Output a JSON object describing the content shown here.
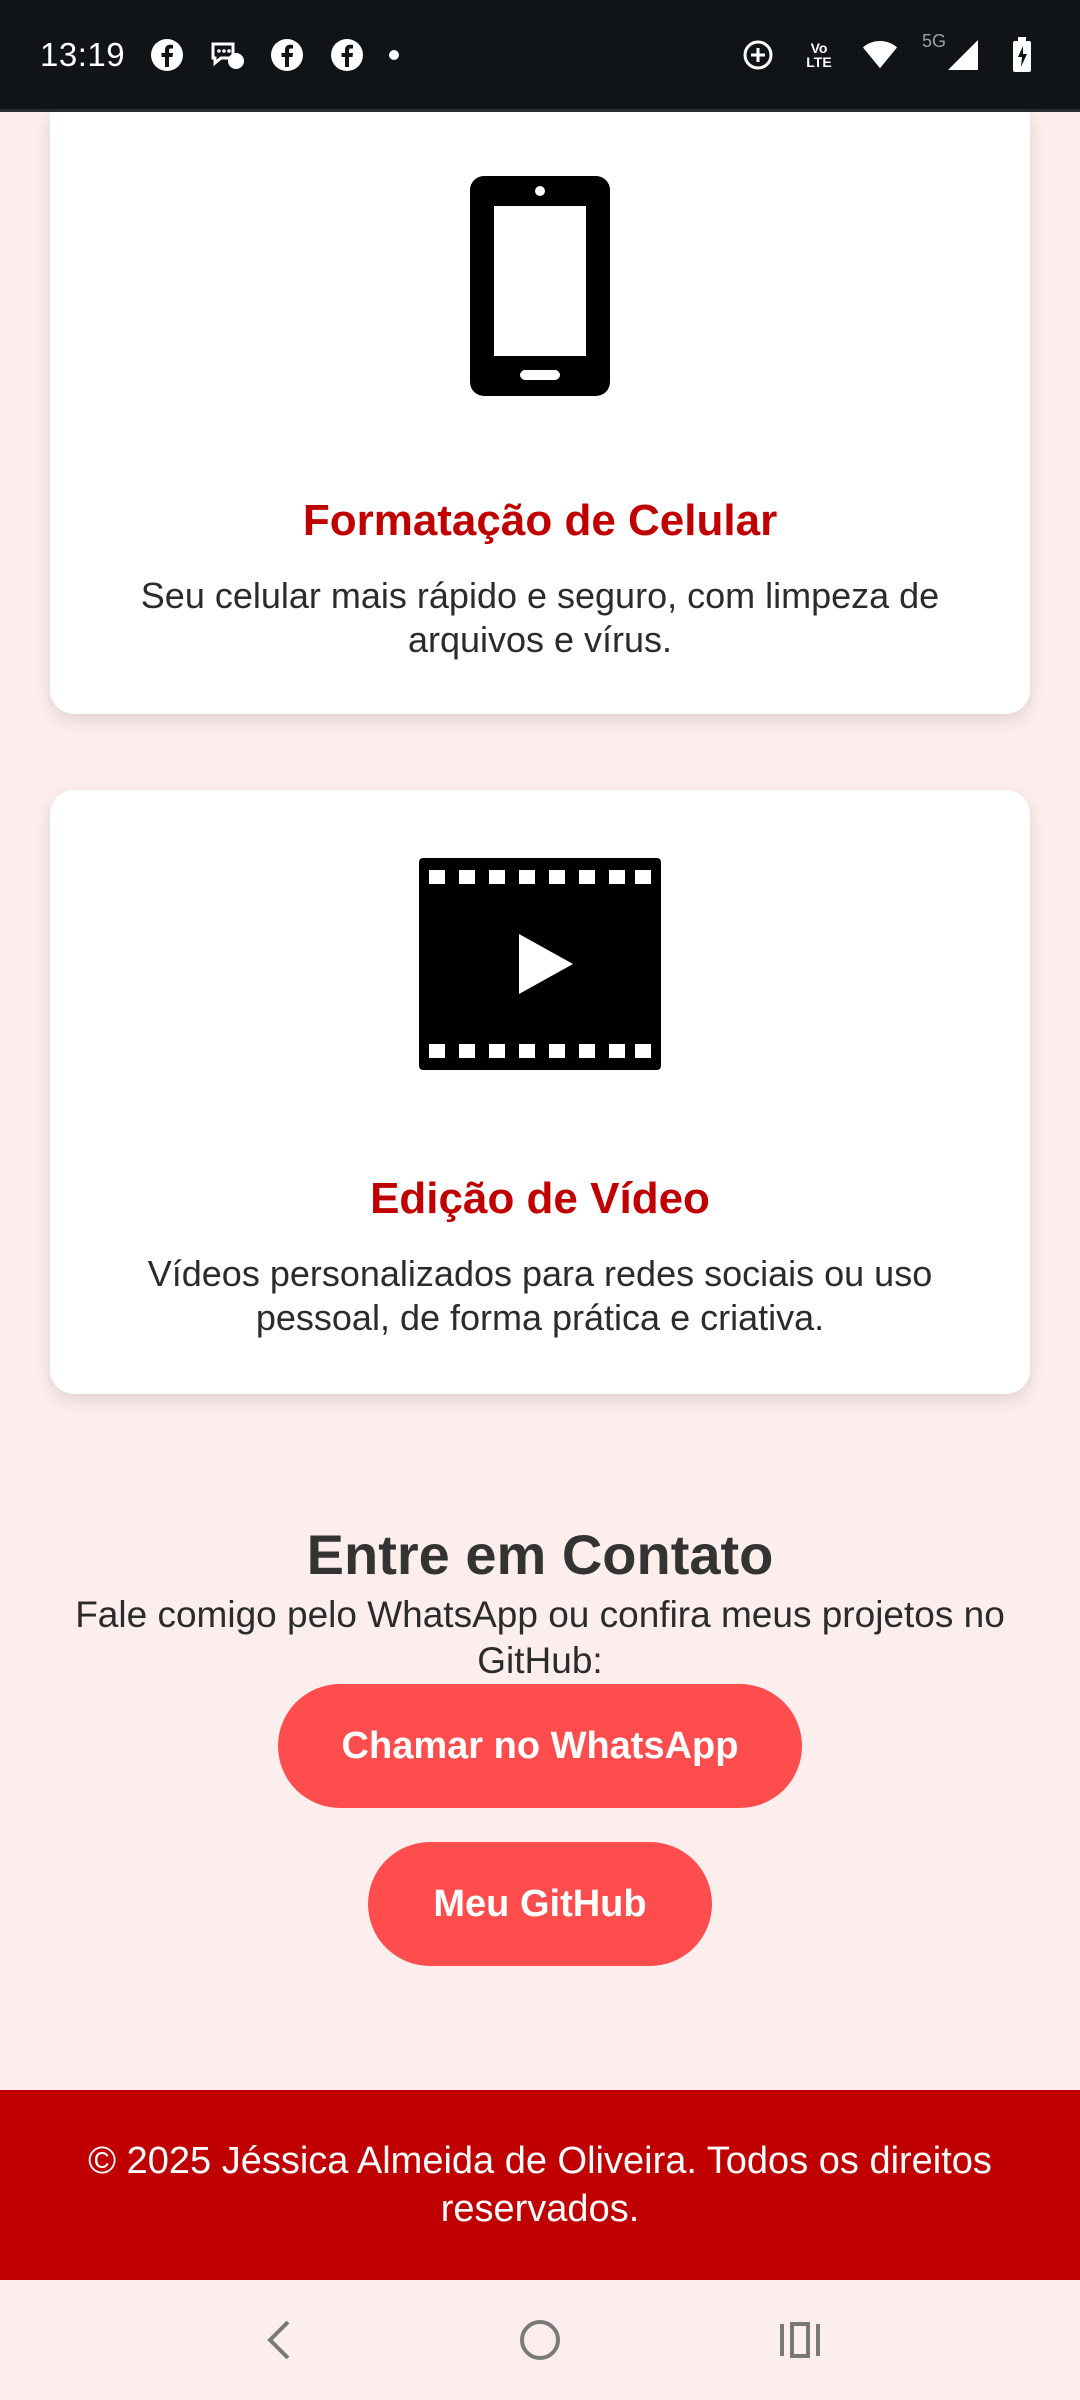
{
  "status_bar": {
    "time": "13:19",
    "left_icons": [
      "facebook-icon",
      "messenger-icon",
      "facebook-icon",
      "facebook-icon",
      "more-notifications-dot-icon"
    ],
    "right_icons": [
      "data-saver-icon",
      "volte-icon",
      "wifi-icon",
      "cellular-5g-icon",
      "battery-icon"
    ],
    "network_label": "5G",
    "volte_top": "Vo",
    "volte_bottom": "LTE"
  },
  "services": [
    {
      "icon": "smartphone-icon",
      "title": "Formatação de Celular",
      "description": "Seu celular mais rápido e seguro, com limpeza de arquivos e vírus."
    },
    {
      "icon": "video-film-icon",
      "title": "Edição de Vídeo",
      "description": "Vídeos personalizados para redes sociais ou uso pessoal, de forma prática e criativa."
    }
  ],
  "contact": {
    "title": "Entre em Contato",
    "text": "Fale comigo pelo WhatsApp ou confira meus projetos no GitHub:",
    "whatsapp_button": "Chamar no WhatsApp",
    "github_button": "Meu GitHub"
  },
  "footer": {
    "text": "© 2025 Jéssica Almeida de Oliveira. Todos os direitos reservados."
  },
  "colors": {
    "page_background": "#fdeeee",
    "accent_red": "#c00000",
    "button_red": "#ff4d4d",
    "status_bar": "#111417"
  },
  "nav_bar": {
    "icons": [
      "back-icon",
      "home-icon",
      "recents-icon"
    ]
  }
}
